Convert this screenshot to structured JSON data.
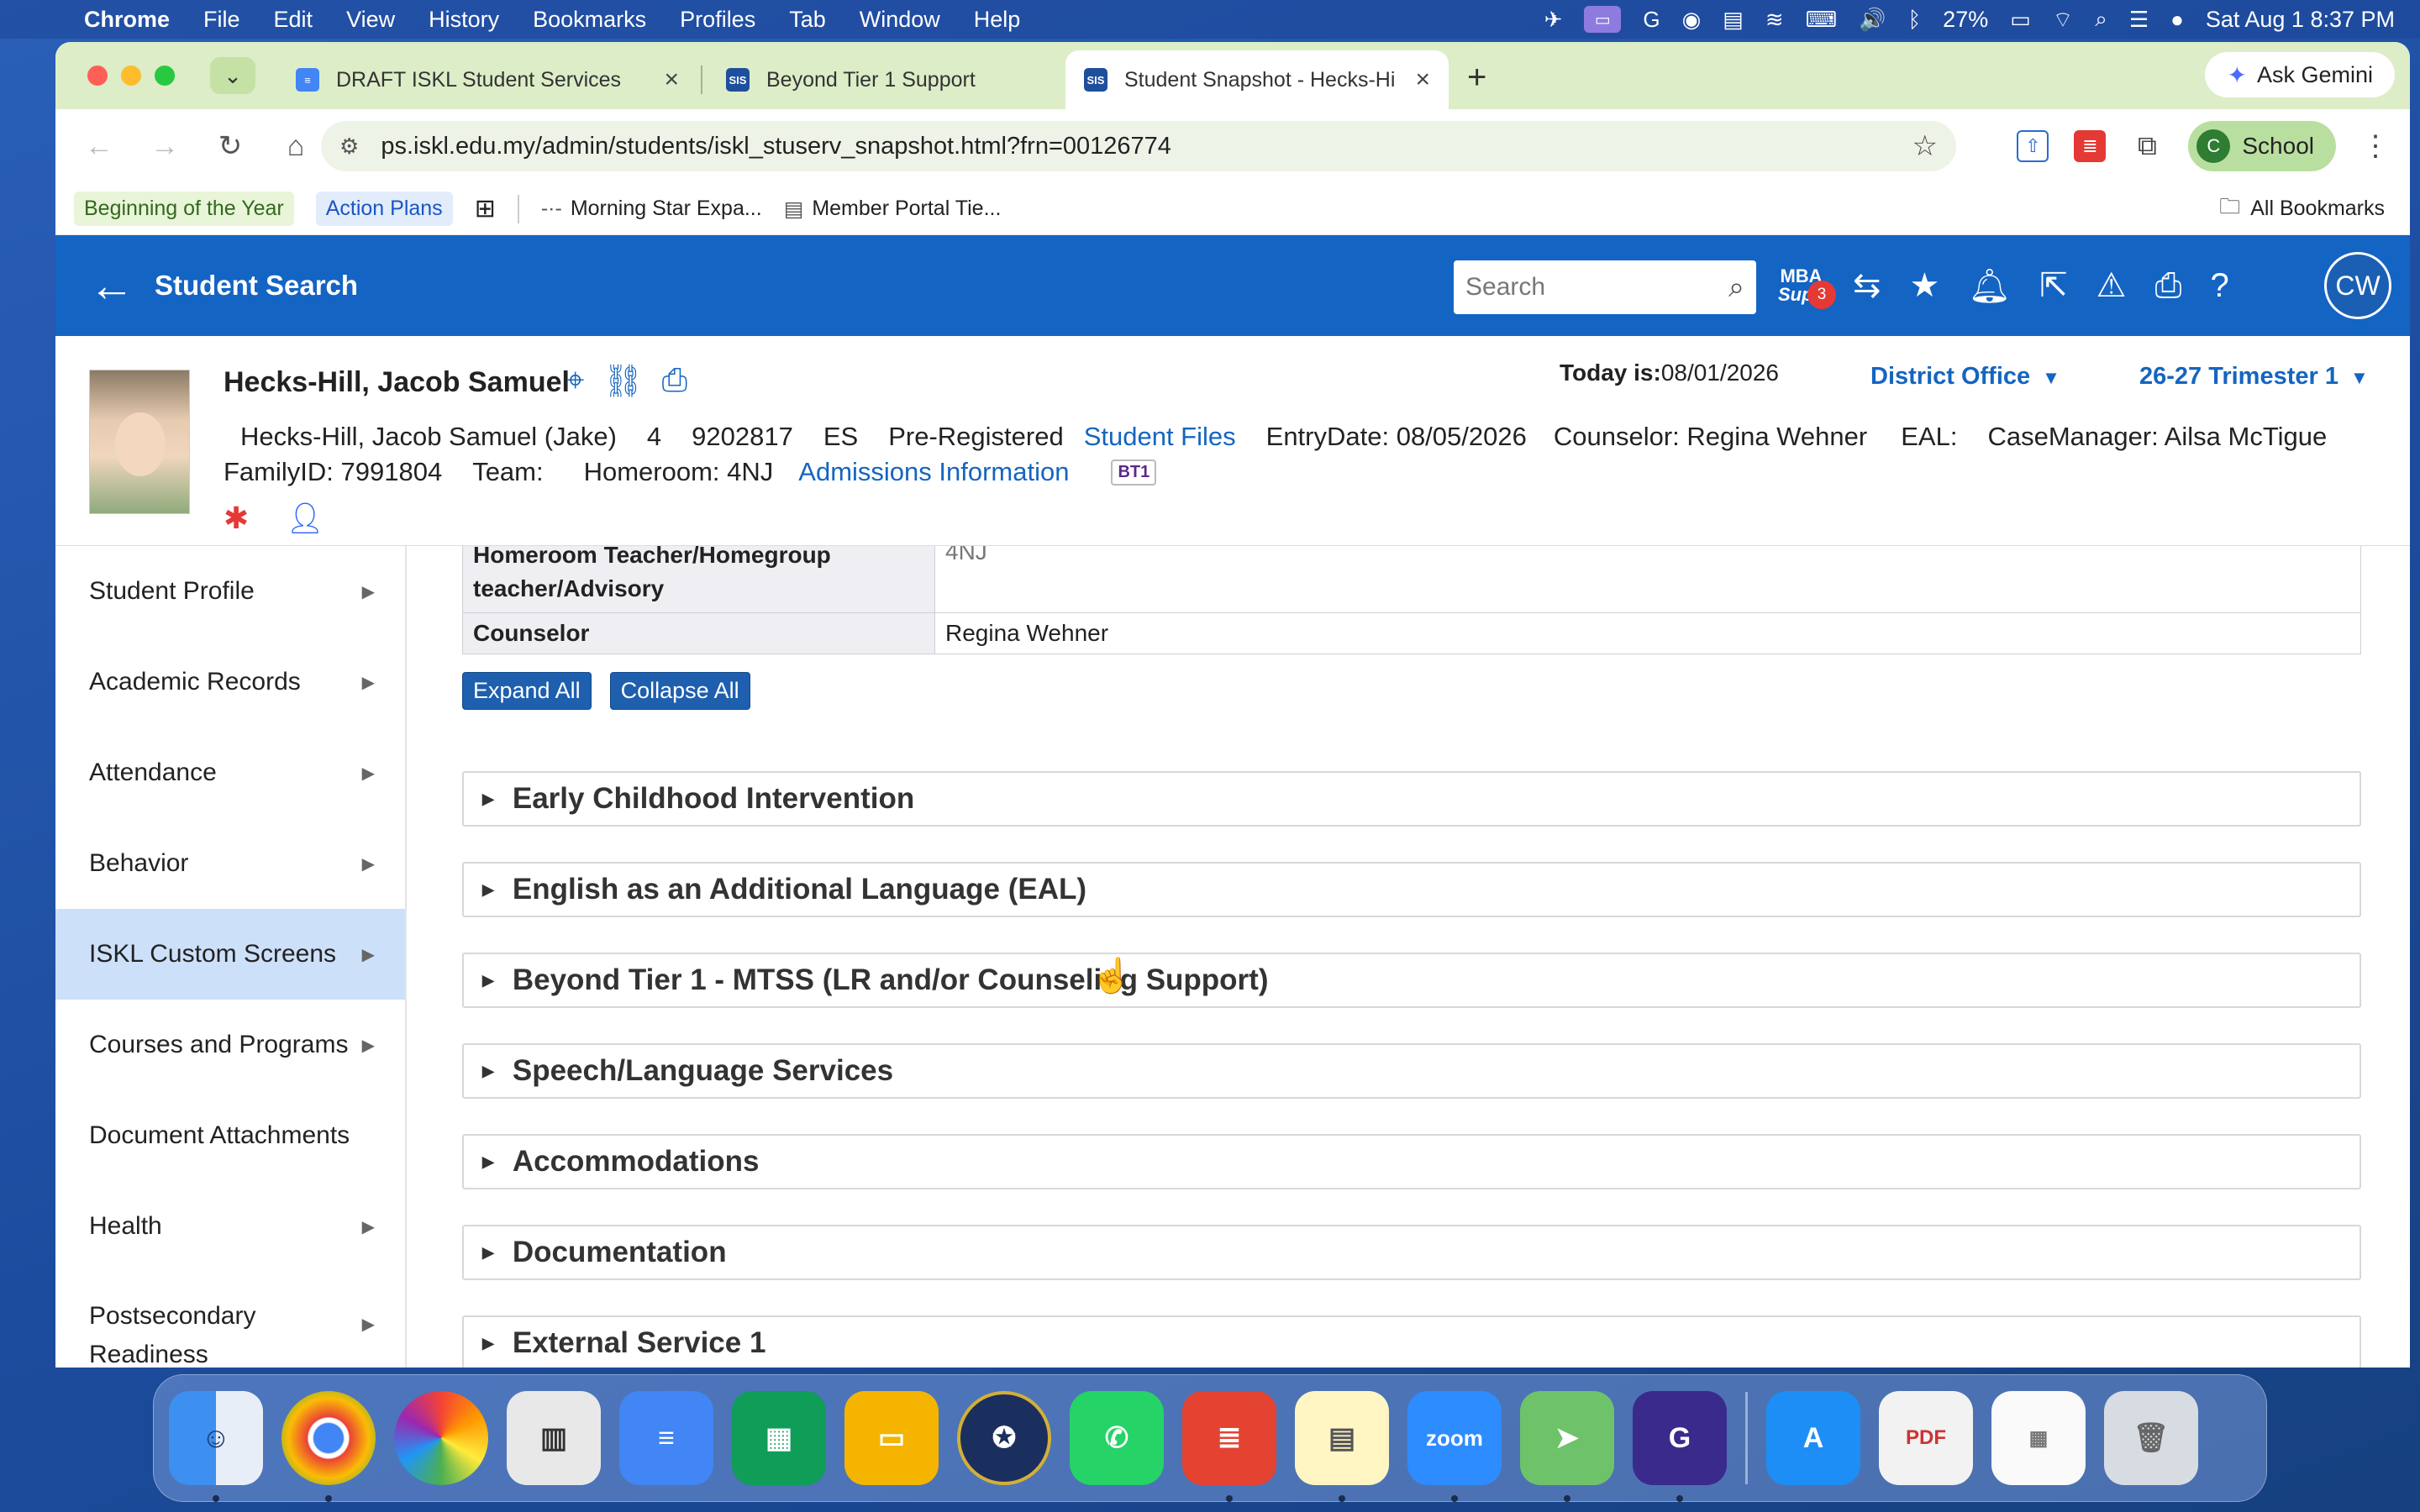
{
  "menubar": {
    "app": "Chrome",
    "items": [
      "File",
      "Edit",
      "View",
      "History",
      "Bookmarks",
      "Profiles",
      "Tab",
      "Window",
      "Help"
    ],
    "battery": "27%",
    "datetime": "Sat Aug 1  8:37 PM"
  },
  "tabs": [
    {
      "title": "DRAFT ISKL Student Services",
      "icon": "docs-icon"
    },
    {
      "title": "Beyond Tier 1 Support",
      "icon": "sis-icon"
    },
    {
      "title": "Student Snapshot - Hecks-Hi",
      "icon": "sis-icon"
    }
  ],
  "ask_gemini": "Ask Gemini",
  "url": "ps.iskl.edu.my/admin/students/iskl_stuserv_snapshot.html?frn=00126774",
  "profile": {
    "initial": "C",
    "name": "School"
  },
  "bookmarks": {
    "items": [
      "Beginning of the Year",
      "Action Plans",
      "Morning Star Expa...",
      "Member Portal Tie..."
    ],
    "all": "All Bookmarks"
  },
  "header": {
    "title": "Student Search",
    "search_placeholder": "Search",
    "mba_label": "MBA",
    "mba_sub": "Supp",
    "mba_badge": "3",
    "user_initials": "CW"
  },
  "student": {
    "name": "Hecks-Hill, Jacob Samuel",
    "today_label": "Today is:",
    "today_value": "08/01/2026",
    "school": "District Office",
    "term": "26-27 Trimester 1",
    "full_name": "Hecks-Hill, Jacob Samuel (Jake)",
    "grade": "4",
    "student_number": "9202817",
    "school_code": "ES",
    "status": "Pre-Registered",
    "files_link": "Student Files",
    "entry_date": "EntryDate: 08/05/2026",
    "counselor": "Counselor: Regina Wehner",
    "eal": "EAL:",
    "case_manager": "CaseManager: Ailsa McTigue",
    "family_id": "FamilyID: 7991804",
    "team": "Team:",
    "homeroom": "Homeroom: 4NJ",
    "admissions_link": "Admissions Information",
    "bt1_badge": "BT1"
  },
  "sidebar": {
    "items": [
      {
        "label": "Student Profile"
      },
      {
        "label": "Academic Records"
      },
      {
        "label": "Attendance"
      },
      {
        "label": "Behavior"
      },
      {
        "label": "ISKL Custom Screens"
      },
      {
        "label": "Courses and Programs"
      },
      {
        "label": "Document Attachments"
      },
      {
        "label": "Health"
      },
      {
        "label": "Postsecondary Readiness"
      }
    ]
  },
  "table": {
    "row1_label": "Homeroom Teacher/Homegroup teacher/Advisory",
    "row1_value": "4NJ",
    "row2_label": "Counselor",
    "row2_value": "Regina Wehner"
  },
  "buttons": {
    "expand": "Expand All",
    "collapse": "Collapse All"
  },
  "sections": [
    "Early Childhood Intervention",
    "English as an Additional Language (EAL)",
    "Beyond Tier 1 - MTSS (LR and/or Counseling Support)",
    "Speech/Language Services",
    "Accommodations",
    "Documentation",
    "External Service 1"
  ]
}
